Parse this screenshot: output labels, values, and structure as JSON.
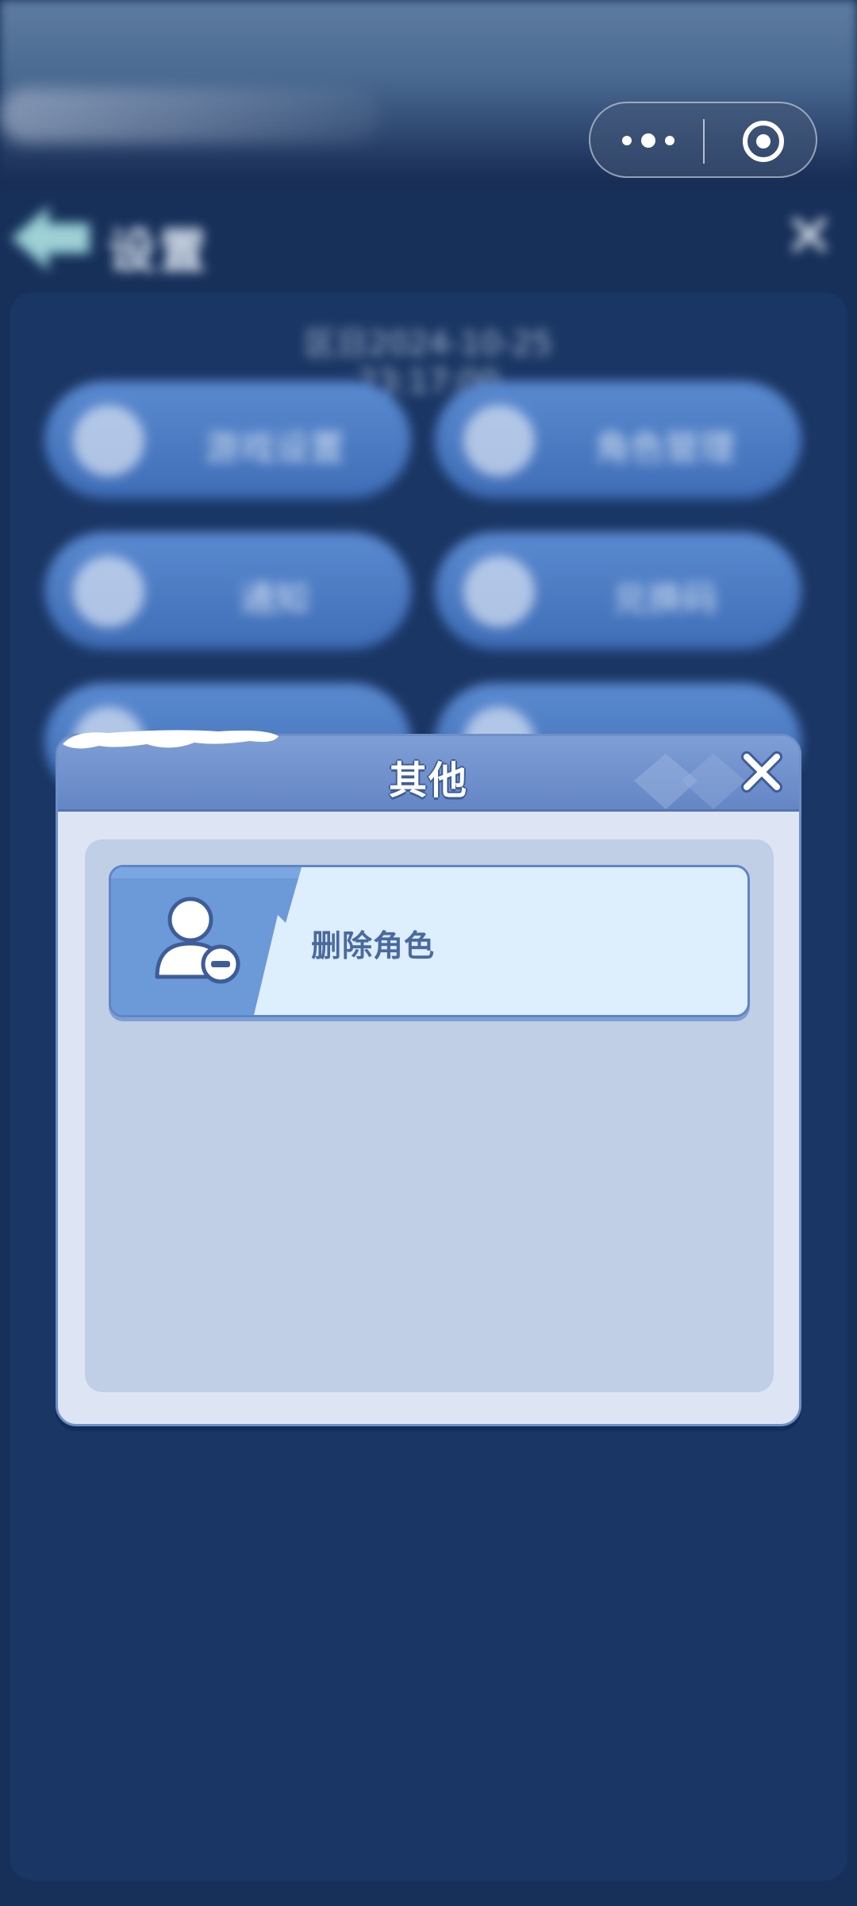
{
  "system_capsule": {
    "more_icon": "more-dots-icon",
    "close_icon": "target-circle-icon"
  },
  "background": {
    "header": {
      "title": "设置",
      "close_icon": "close-x-icon"
    },
    "timestamp": "区日2024-10-25 23:17:00",
    "grid_buttons": [
      {
        "label": "游戏设置",
        "icon": "gear-icon"
      },
      {
        "label": "角色管理",
        "icon": "person-icon"
      },
      {
        "label": "通知",
        "icon": "bell-icon"
      },
      {
        "label": "兑换码",
        "icon": "gift-icon"
      },
      {
        "label": "",
        "icon": "circle-icon"
      },
      {
        "label": "",
        "icon": "circle-icon"
      }
    ]
  },
  "dialog": {
    "title": "其他",
    "close_icon": "close-x-icon",
    "options": [
      {
        "label": "删除角色",
        "icon": "person-minus-icon"
      }
    ]
  },
  "colors": {
    "dialog_header": "#6a8bc8",
    "dialog_body": "#dde5f4",
    "option_bg": "#ddeefc",
    "option_band": "#6c99d8",
    "label_text": "#4a6a9e"
  }
}
